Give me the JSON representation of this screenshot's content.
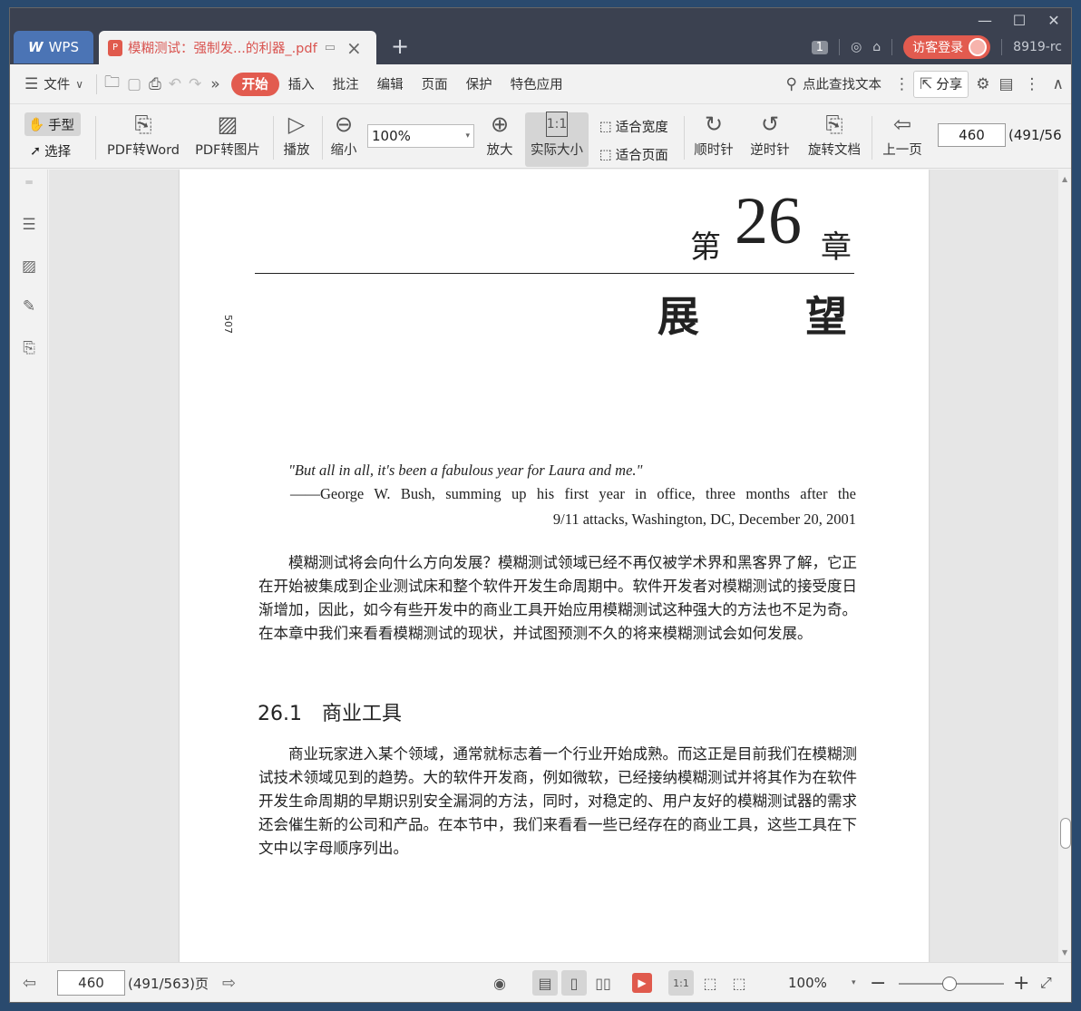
{
  "titlebar": {
    "app_tab": "WPS",
    "doc_tab": "模糊测试：强制发...的利器_.pdf",
    "badge": "1",
    "login": "访客登录",
    "user_code": "8919-rc"
  },
  "menubar": {
    "file": "文件",
    "items": [
      "开始",
      "插入",
      "批注",
      "编辑",
      "页面",
      "保护",
      "特色应用"
    ],
    "search": "点此查找文本",
    "share": "分享"
  },
  "toolbar": {
    "hand": "手型",
    "select": "选择",
    "pdf_word": "PDF转Word",
    "pdf_img": "PDF转图片",
    "play": "播放",
    "zoom_out": "缩小",
    "zoom_value": "100%",
    "zoom_in": "放大",
    "actual_size": "实际大小",
    "fit_width": "适合宽度",
    "fit_page": "适合页面",
    "rot_cw": "顺时针",
    "rot_ccw": "逆时针",
    "rotate_doc": "旋转文档",
    "prev_page": "上一页",
    "page_value": "460",
    "page_total": "(491/56"
  },
  "page": {
    "ch_di": "第",
    "ch_num": "26",
    "ch_zhang": "章",
    "title_a": "展",
    "title_b": "望",
    "side_num": "507",
    "quote": "\"But all in all, it's been a fabulous year for Laura and me.\"",
    "attr1": "——George W. Bush, summing up his first year in office, three months after the",
    "attr2": "9/11 attacks, Washington, DC, December 20, 2001",
    "para1": "模糊测试将会向什么方向发展？模糊测试领域已经不再仅被学术界和黑客界了解，它正在开始被集成到企业测试床和整个软件开发生命周期中。软件开发者对模糊测试的接受度日渐增加，因此，如今有些开发中的商业工具开始应用模糊测试这种强大的方法也不足为奇。在本章中我们来看看模糊测试的现状，并试图预测不久的将来模糊测试会如何发展。",
    "section": "26.1　商业工具",
    "para2": "商业玩家进入某个领域，通常就标志着一个行业开始成熟。而这正是目前我们在模糊测试技术领域见到的趋势。大的软件开发商，例如微软，已经接纳模糊测试并将其作为在软件开发生命周期的早期识别安全漏洞的方法，同时，对稳定的、用户友好的模糊测试器的需求还会催生新的公司和产品。在本节中，我们来看看一些已经存在的商业工具，这些工具在下文中以字母顺序列出。"
  },
  "statusbar": {
    "page_value": "460",
    "page_total": "(491/563)页",
    "zoom": "100%"
  }
}
